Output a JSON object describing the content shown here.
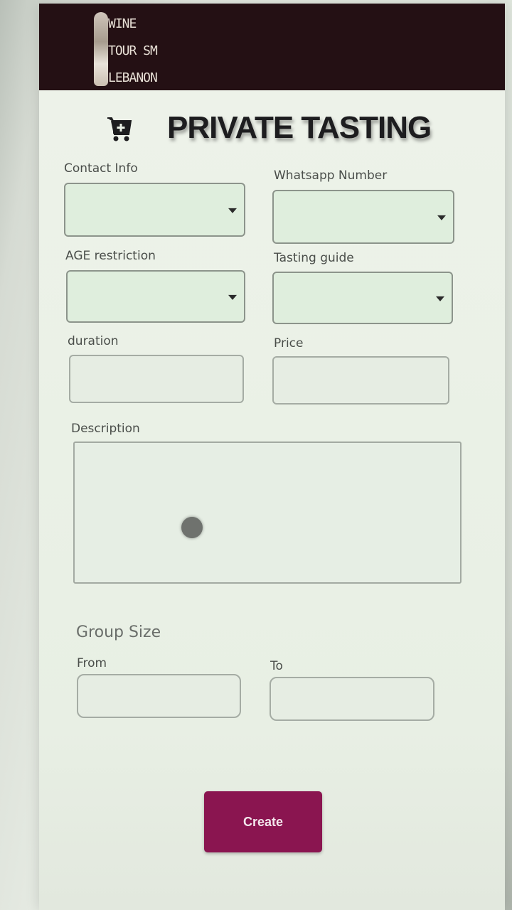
{
  "header": {
    "logo_lines": [
      "WINE",
      "TOURISM",
      "LEBANON"
    ],
    "logo_text_display": [
      "WINE",
      "TOUR SM",
      "LEBANON"
    ]
  },
  "page": {
    "title": "PRIVATE TASTING",
    "title_icon": "cart-plus-icon"
  },
  "form": {
    "contact_info_label": "Contact Info",
    "whatsapp_label": "Whatsapp Number",
    "age_label": "AGE restriction",
    "guide_label": "Tasting guide",
    "duration_label": "duration",
    "price_label": "Price",
    "description_label": "Description",
    "group_size_title": "Group Size",
    "from_label": "From",
    "to_label": "To",
    "create_label": "Create"
  },
  "colors": {
    "header_bg": "#241014",
    "accent_button": "#8a1550",
    "field_bg": "#dfeedd"
  }
}
